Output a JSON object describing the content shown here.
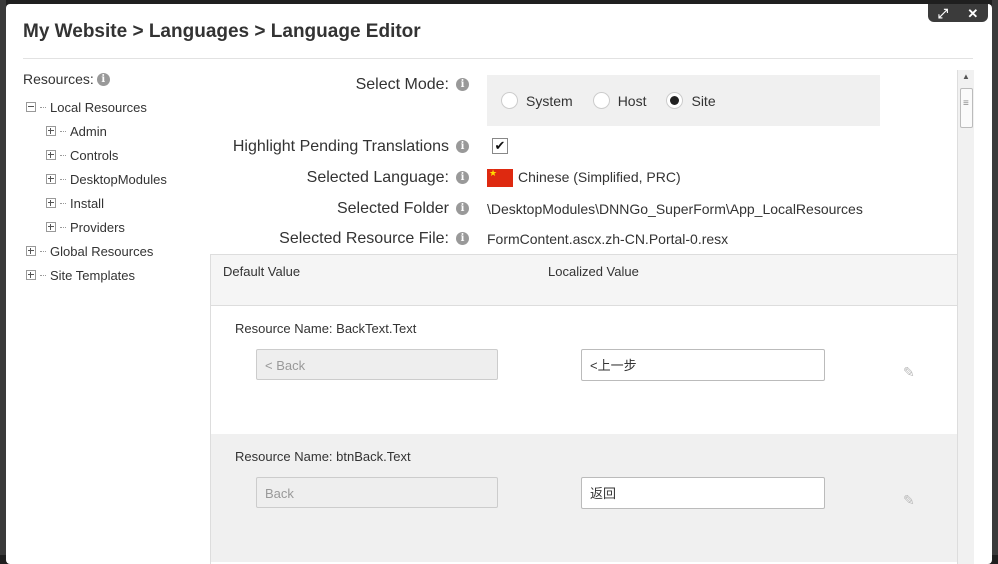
{
  "breadcrumb": "My Website > Languages > Language Editor",
  "window_controls": {
    "expand": "⤢",
    "close": "✕"
  },
  "tree": {
    "label": "Resources:",
    "nodes": [
      {
        "label": "Local Resources",
        "level": 0,
        "expanded": true
      },
      {
        "label": "Admin",
        "level": 1
      },
      {
        "label": "Controls",
        "level": 1
      },
      {
        "label": "DesktopModules",
        "level": 1
      },
      {
        "label": "Install",
        "level": 1
      },
      {
        "label": "Providers",
        "level": 1
      },
      {
        "label": "Global Resources",
        "level": 0
      },
      {
        "label": "Site Templates",
        "level": 0
      }
    ]
  },
  "form": {
    "select_mode_label": "Select Mode:",
    "modes": [
      "System",
      "Host",
      "Site"
    ],
    "selected_mode": "Site",
    "highlight_label": "Highlight Pending Translations",
    "highlight_checked": true,
    "language_label": "Selected Language:",
    "language_value": "Chinese (Simplified, PRC)",
    "folder_label": "Selected Folder",
    "folder_value": "\\DesktopModules\\DNNGo_SuperForm\\App_LocalResources",
    "file_label": "Selected Resource File:",
    "file_value": "FormContent.ascx.zh-CN.Portal-0.resx"
  },
  "grid": {
    "col_default": "Default Value",
    "col_localized": "Localized Value",
    "rows": [
      {
        "name": "Resource Name: BackText.Text",
        "default": "< Back",
        "localized": "<上一步"
      },
      {
        "name": "Resource Name: btnBack.Text",
        "default": "Back",
        "localized": "返回"
      }
    ]
  },
  "icons": {
    "info": "info-icon",
    "edit": "pencil-icon"
  }
}
